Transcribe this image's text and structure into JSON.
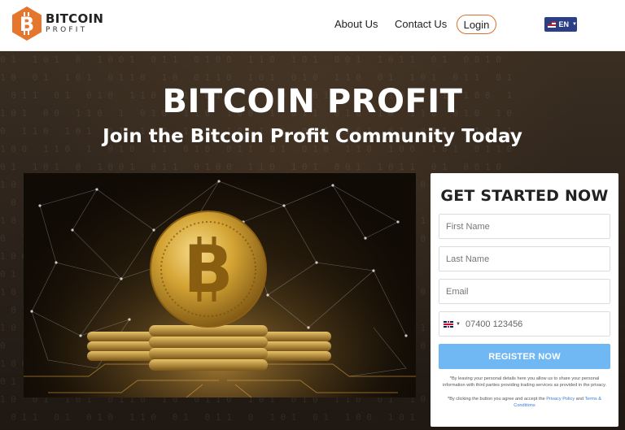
{
  "header": {
    "logo": {
      "title": "BITCOIN",
      "subtitle": "PROFIT",
      "brand_color": "#e4762d"
    },
    "nav": {
      "about_label": "About Us",
      "contact_label": "Contact Us",
      "login_label": "Login"
    },
    "language": {
      "code": "EN",
      "flag": "us-flag-icon"
    }
  },
  "hero": {
    "title": "BITCOIN PROFIT",
    "subtitle": "Join the Bitcoin Profit Community Today",
    "image": "bitcoin-coin-network-image"
  },
  "form": {
    "title": "GET STARTED NOW",
    "first_name_placeholder": "First Name",
    "last_name_placeholder": "Last Name",
    "email_placeholder": "Email",
    "phone_country_flag": "uk-flag-icon",
    "phone_placeholder": "07400 123456",
    "register_label": "REGISTER NOW",
    "disclaimer_1": "*By leaving your personal details here you allow us to share your personal information with third parties providing trading services as provided in the privacy.",
    "disclaimer_2_prefix": "*By clicking the button you agree and accept the ",
    "privacy_link": "Privacy Policy",
    "disclaimer_2_and": " and ",
    "terms_link": "Terms & Conditions",
    "button_color": "#6fb8f3"
  }
}
